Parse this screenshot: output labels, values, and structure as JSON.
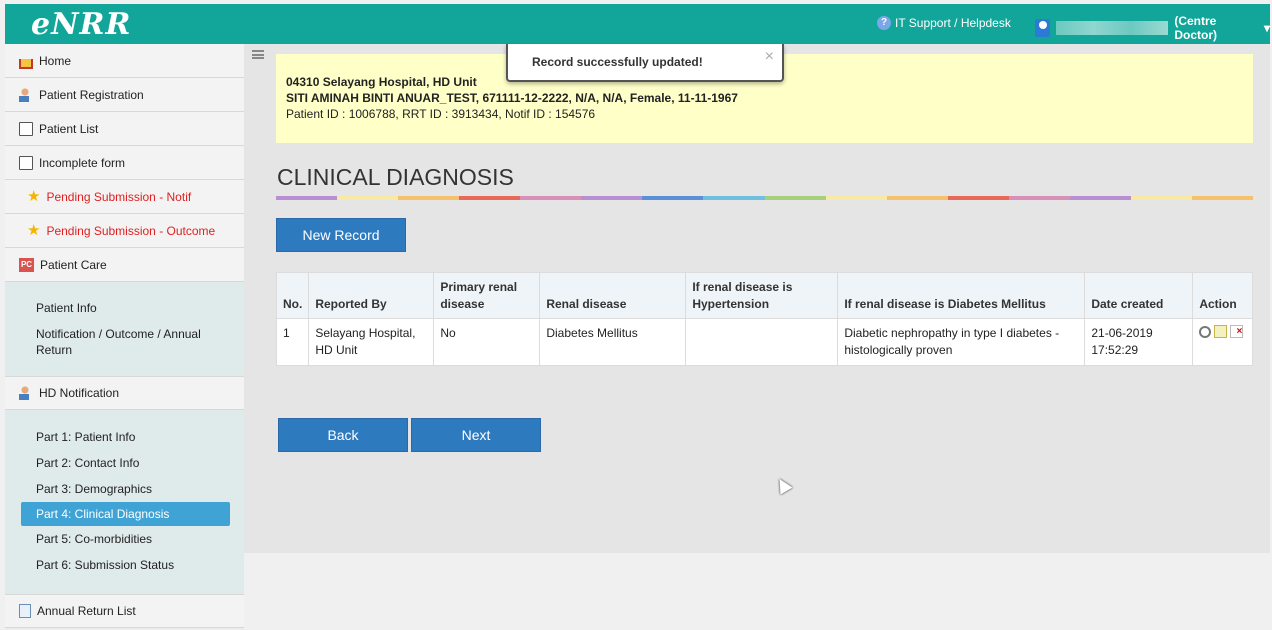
{
  "header": {
    "logo": "eNRR",
    "helpdesk_label": "IT Support / Helpdesk",
    "user_role": "(Centre Doctor)",
    "dropdown_caret": "▾",
    "bg_color": "#12a69a"
  },
  "sidebar": {
    "home": "Home",
    "patient_registration": "Patient Registration",
    "patient_list": "Patient List",
    "incomplete_form": "Incomplete form",
    "pending_notif": "Pending Submission - Notif",
    "pending_outcome": "Pending Submission - Outcome",
    "patient_care": "Patient Care",
    "patient_care_sub": [
      "Patient Info",
      "Notification / Outcome / Annual Return"
    ],
    "hd_notification": "HD Notification",
    "hd_sub": [
      "Part 1: Patient Info",
      "Part 2: Contact Info",
      "Part 3: Demographics",
      "Part 4: Clinical Diagnosis",
      "Part 5: Co-morbidities",
      "Part 6: Submission Status"
    ],
    "annual_return_list": "Annual Return List"
  },
  "toast": {
    "message": "Record successfully updated!",
    "close": "×"
  },
  "patient": {
    "unit": "04310 Selayang Hospital, HD Unit",
    "details": "SITI AMINAH BINTI ANUAR_TEST, 671111-12-2222, N/A, N/A, Female, 11-11-1967",
    "ids": "Patient ID : 1006788, RRT ID : 3913434, Notif ID : 154576"
  },
  "page": {
    "title": "CLINICAL DIAGNOSIS",
    "new_record": "New Record",
    "back": "Back",
    "next": "Next"
  },
  "table": {
    "headers": [
      "No.",
      "Reported By",
      "Primary renal disease",
      "Renal disease",
      "If renal disease is Hypertension",
      "If renal disease is Diabetes Mellitus",
      "Date created",
      "Action"
    ],
    "rows": [
      [
        "1",
        "Selayang Hospital, HD Unit",
        "No",
        "Diabetes Mellitus",
        "",
        "Diabetic nephropathy in type I diabetes - histologically proven",
        "21-06-2019 17:52:29"
      ]
    ]
  },
  "rainbow_colors": [
    "#b88fd0",
    "#f7e9a6",
    "#f5c26b",
    "#e8685a",
    "#d88fb8",
    "#b88fd0",
    "#5b8fd6",
    "#6fc0e0",
    "#a7d07a",
    "#f7e9a6",
    "#f5c26b",
    "#e8685a",
    "#d88fb8",
    "#b88fd0",
    "#f7e9a6",
    "#f5c26b"
  ]
}
